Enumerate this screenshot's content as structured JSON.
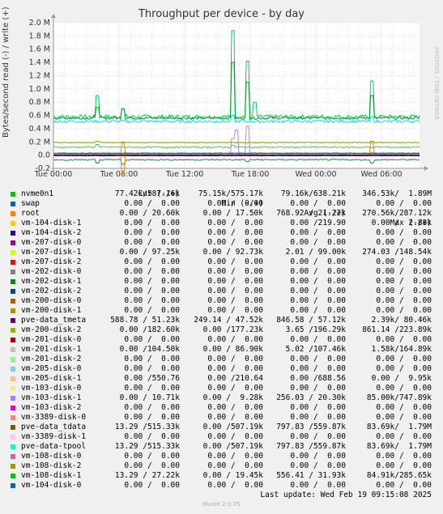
{
  "header": {
    "title": "Throughput per device - by day",
    "side_note": "RRDTOOL / TOBI OETIKER"
  },
  "chart_data": {
    "type": "line",
    "title": "Throughput per device - by day",
    "ylabel": "Bytes/second read (-) / write (+)",
    "ylim": [
      -0.2,
      2.0
    ],
    "y_ticks": [
      "2.0 M",
      "1.8 M",
      "1.6 M",
      "1.4 M",
      "1.2 M",
      "1.0 M",
      "0.8 M",
      "0.6 M",
      "0.4 M",
      "0.2 M",
      "0.0",
      "-0.2"
    ],
    "x_ticks": [
      "Tue 00:00",
      "Tue 06:00",
      "Tue 12:00",
      "Tue 18:00",
      "Wed 00:00",
      "Wed 06:00"
    ],
    "grid": true,
    "series": [
      {
        "name": "pve-data_tdata write",
        "color": "#00cc66",
        "base": 0.58,
        "noise": 0.03,
        "spikes": [
          [
            0.12,
            0.9
          ],
          [
            0.49,
            1.88
          ],
          [
            0.53,
            1.42
          ],
          [
            0.55,
            0.8
          ],
          [
            0.87,
            1.12
          ],
          [
            0.19,
            0.7
          ]
        ]
      },
      {
        "name": "nvme0n1 write",
        "color": "#00a020",
        "base": 0.56,
        "noise": 0.02,
        "spikes": [
          [
            0.12,
            0.72
          ],
          [
            0.49,
            1.4
          ],
          [
            0.53,
            1.1
          ],
          [
            0.87,
            0.9
          ],
          [
            0.19,
            0.7
          ]
        ]
      },
      {
        "name": "pve-data-tpool write",
        "color": "#00e8e8",
        "base": 0.51,
        "noise": 0.02,
        "spikes": [
          [
            0.49,
            0.6
          ],
          [
            0.87,
            0.58
          ]
        ]
      },
      {
        "name": "vm-103-disk-1 write",
        "color": "#b088ff",
        "base": 0.0,
        "noise": 0.0,
        "spikes": [
          [
            0.5,
            0.38
          ],
          [
            0.53,
            0.44
          ],
          [
            0.49,
            0.25
          ]
        ]
      },
      {
        "name": "vm-200-disk-2 write",
        "color": "#94a000",
        "base": 0.19,
        "noise": 0.005,
        "spikes": [
          [
            0.12,
            0.21
          ],
          [
            0.87,
            0.21
          ]
        ]
      },
      {
        "name": "root write",
        "color": "#ee8800",
        "base": 0.0,
        "noise": 0.0,
        "spikes": [
          [
            0.19,
            0.2
          ],
          [
            0.87,
            0.19
          ]
        ]
      },
      {
        "name": "vm-108-disk-1 write",
        "color": "#40cc40",
        "base": 0.12,
        "noise": 0.01,
        "spikes": [
          [
            0.12,
            0.16
          ],
          [
            0.49,
            0.15
          ]
        ]
      },
      {
        "name": "pve-data_tmeta read",
        "color": "#7a0078",
        "base": -0.01,
        "noise": 0.002,
        "spikes": []
      },
      {
        "name": "nvme0n1 read",
        "color": "#00a020",
        "base": -0.07,
        "noise": 0.01,
        "spikes": [
          [
            0.12,
            -0.12
          ],
          [
            0.19,
            -0.14
          ],
          [
            0.53,
            -0.1
          ],
          [
            0.87,
            -0.12
          ]
        ]
      },
      {
        "name": "root read",
        "color": "#ee8800",
        "base": 0.0,
        "noise": 0.0,
        "spikes": [
          [
            0.19,
            -0.28
          ]
        ]
      },
      {
        "name": "vm-104-disk-0 read",
        "color": "#208080",
        "base": 0.02,
        "noise": 0.003,
        "spikes": []
      },
      {
        "name": "vm-200-disk-0 read",
        "color": "#444444",
        "base": 0.03,
        "noise": 0.003,
        "spikes": []
      }
    ]
  },
  "legend": {
    "headers": {
      "cur": "Cur (-/+)",
      "min": "Min (-/+)",
      "avg": "Avg (-/+)",
      "max": "Max (-/+)"
    },
    "rows": [
      {
        "name": "nvme0n1",
        "color": "#00cc00",
        "cur": "77.42k/587.16k",
        "min": "75.15k/575.17k",
        "avg": "79.16k/638.21k",
        "max": "346.53k/  1.89M"
      },
      {
        "name": "swap",
        "color": "#0066b3",
        "cur": "0.00 /  0.00",
        "min": "0.00 /  0.00",
        "avg": "0.00 /  0.00",
        "max": "0.00 /  0.00"
      },
      {
        "name": "root",
        "color": "#ff8000",
        "cur": "0.00 / 20.60k",
        "min": "0.00 / 17.50k",
        "avg": "768.92 / 21.22k",
        "max": "270.56k/287.12k"
      },
      {
        "name": "vm-104-disk-1",
        "color": "#ffcc00",
        "cur": "0.00 /  0.00",
        "min": "0.00 /  0.00",
        "avg": "0.00 /219.90",
        "max": "0.00 /  2.88k"
      },
      {
        "name": "vm-104-disk-2",
        "color": "#330099",
        "cur": "0.00 /  0.00",
        "min": "0.00 /  0.00",
        "avg": "0.00 /  0.00",
        "max": "0.00 /  0.00"
      },
      {
        "name": "vm-207-disk-0",
        "color": "#990099",
        "cur": "0.00 /  0.00",
        "min": "0.00 /  0.00",
        "avg": "0.00 /  0.00",
        "max": "0.00 /  0.00"
      },
      {
        "name": "vm-207-disk-1",
        "color": "#ccff00",
        "cur": "0.00 / 97.25k",
        "min": "0.00 / 92.73k",
        "avg": "2.01 / 99.00k",
        "max": "274.03 /148.54k"
      },
      {
        "name": "vm-207-disk-2",
        "color": "#ff0000",
        "cur": "0.00 /  0.00",
        "min": "0.00 /  0.00",
        "avg": "0.00 /  0.00",
        "max": "0.00 /  0.00"
      },
      {
        "name": "vm-202-disk-0",
        "color": "#808080",
        "cur": "0.00 /  0.00",
        "min": "0.00 /  0.00",
        "avg": "0.00 /  0.00",
        "max": "0.00 /  0.00"
      },
      {
        "name": "vm-202-disk-1",
        "color": "#008f00",
        "cur": "0.00 /  0.00",
        "min": "0.00 /  0.00",
        "avg": "0.00 /  0.00",
        "max": "0.00 /  0.00"
      },
      {
        "name": "vm-202-disk-2",
        "color": "#00487d",
        "cur": "0.00 /  0.00",
        "min": "0.00 /  0.00",
        "avg": "0.00 /  0.00",
        "max": "0.00 /  0.00"
      },
      {
        "name": "vm-200-disk-0",
        "color": "#b35a00",
        "cur": "0.00 /  0.00",
        "min": "0.00 /  0.00",
        "avg": "0.00 /  0.00",
        "max": "0.00 /  0.00"
      },
      {
        "name": "vm-200-disk-1",
        "color": "#b38f00",
        "cur": "0.00 /  0.00",
        "min": "0.00 /  0.00",
        "avg": "0.00 /  0.00",
        "max": "0.00 /  0.00"
      },
      {
        "name": "pve-data_tmeta",
        "color": "#6b006b",
        "cur": "588.78 / 51.23k",
        "min": "249.14 / 47.52k",
        "avg": "846.58 / 57.12k",
        "max": "2.39k/ 80.46k"
      },
      {
        "name": "vm-200-disk-2",
        "color": "#8fb300",
        "cur": "0.00 /182.60k",
        "min": "0.00 /177.23k",
        "avg": "3.65 /196.29k",
        "max": "861.14 /223.89k"
      },
      {
        "name": "vm-201-disk-0",
        "color": "#b30000",
        "cur": "0.00 /  0.00",
        "min": "0.00 /  0.00",
        "avg": "0.00 /  0.00",
        "max": "0.00 /  0.00"
      },
      {
        "name": "vm-201-disk-1",
        "color": "#bebebe",
        "cur": "0.00 /104.50k",
        "min": "0.00 / 86.90k",
        "avg": "5.02 /107.46k",
        "max": "1.58k/164.89k"
      },
      {
        "name": "vm-201-disk-2",
        "color": "#80ff80",
        "cur": "0.00 /  0.00",
        "min": "0.00 /  0.00",
        "avg": "0.00 /  0.00",
        "max": "0.00 /  0.00"
      },
      {
        "name": "vm-205-disk-0",
        "color": "#80c9ff",
        "cur": "0.00 /  0.00",
        "min": "0.00 /  0.00",
        "avg": "0.00 /  0.00",
        "max": "0.00 /  0.00"
      },
      {
        "name": "vm-205-disk-1",
        "color": "#ffc080",
        "cur": "0.00 /550.76",
        "min": "0.00 /210.64",
        "avg": "0.00 /688.56",
        "max": "0.00 /  9.95k"
      },
      {
        "name": "vm-103-disk-0",
        "color": "#ffe680",
        "cur": "0.00 /  0.00",
        "min": "0.00 /  0.00",
        "avg": "0.00 /  0.00",
        "max": "0.00 /  0.00"
      },
      {
        "name": "vm-103-disk-1",
        "color": "#aa80ff",
        "cur": "0.00 / 10.71k",
        "min": "0.00 /  9.28k",
        "avg": "256.03 / 20.30k",
        "max": "85.00k/747.89k"
      },
      {
        "name": "vm-103-disk-2",
        "color": "#ee00cc",
        "cur": "0.00 /  0.00",
        "min": "0.00 /  0.00",
        "avg": "0.00 /  0.00",
        "max": "0.00 /  0.00"
      },
      {
        "name": "vm-3389-disk-0",
        "color": "#ff8080",
        "cur": "0.00 /  0.00",
        "min": "0.00 /  0.00",
        "avg": "0.00 /  0.00",
        "max": "0.00 /  0.00"
      },
      {
        "name": "pve-data_tdata",
        "color": "#666600",
        "cur": "13.29 /515.33k",
        "min": "0.00 /507.19k",
        "avg": "797.83 /559.87k",
        "max": "83.69k/  1.79M"
      },
      {
        "name": "vm-3389-disk-1",
        "color": "#ffbfff",
        "cur": "0.00 /  0.00",
        "min": "0.00 /  0.00",
        "avg": "0.00 /  0.00",
        "max": "0.00 /  0.00"
      },
      {
        "name": "pve-data-tpool",
        "color": "#00ffcc",
        "cur": "13.29 /515.33k",
        "min": "0.00 /507.19k",
        "avg": "797.83 /559.87k",
        "max": "83.69k/  1.79M"
      },
      {
        "name": "vm-108-disk-0",
        "color": "#cc6699",
        "cur": "0.00 /  0.00",
        "min": "0.00 /  0.00",
        "avg": "0.00 /  0.00",
        "max": "0.00 /  0.00"
      },
      {
        "name": "vm-108-disk-2",
        "color": "#999900",
        "cur": "0.00 /  0.00",
        "min": "0.00 /  0.00",
        "avg": "0.00 /  0.00",
        "max": "0.00 /  0.00"
      },
      {
        "name": "vm-108-disk-1",
        "color": "#00cc00",
        "cur": "13.29 / 27.22k",
        "min": "0.00 / 19.45k",
        "avg": "556.41 / 31.93k",
        "max": "84.91k/285.65k"
      },
      {
        "name": "vm-104-disk-0",
        "color": "#0066b3",
        "cur": "0.00 /  0.00",
        "min": "0.00 /  0.00",
        "avg": "0.00 /  0.00",
        "max": "0.00 /  0.00"
      }
    ]
  },
  "last_update": "Last update: Wed Feb 19 09:15:08 2025",
  "footer": "Munin 2.0.75"
}
